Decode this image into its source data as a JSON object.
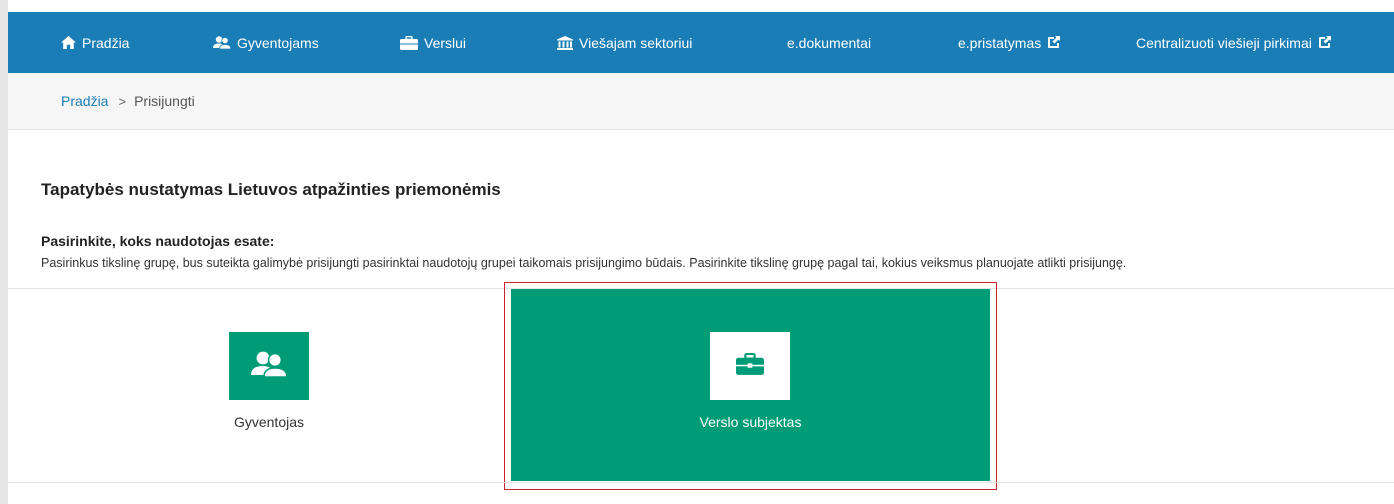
{
  "nav": {
    "items": [
      {
        "label": "Pradžia",
        "icon": "home-icon"
      },
      {
        "label": "Gyventojams",
        "icon": "users-icon"
      },
      {
        "label": "Verslui",
        "icon": "briefcase-icon"
      },
      {
        "label": "Viešajam sektoriui",
        "icon": "institution-icon"
      },
      {
        "label": "e.dokumentai",
        "icon": ""
      },
      {
        "label": "e.pristatymas",
        "icon": "external-link-icon"
      },
      {
        "label": "Centralizuoti viešieji pirkimai",
        "icon": "external-link-icon"
      }
    ]
  },
  "breadcrumb": {
    "home": "Pradžia",
    "separator": ">",
    "current": "Prisijungti"
  },
  "main": {
    "title": "Tapatybės nustatymas Lietuvos atpažinties priemonėmis",
    "subtitle": "Pasirinkite, koks naudotojas esate:",
    "description": "Pasirinkus tikslinę grupę, bus suteikta galimybė prisijungti pasirinktai naudotojų grupei taikomais prisijungimo būdais. Pasirinkite tikslinę grupę pagal tai, kokius veiksmus planuojate atlikti prisijungę."
  },
  "options": {
    "citizen": {
      "label": "Gyventojas",
      "icon": "users-icon"
    },
    "business": {
      "label": "Verslo subjektas",
      "icon": "briefcase-icon",
      "selected": true
    }
  },
  "colors": {
    "nav_bg": "#1a7db5",
    "accent_green": "#009b77",
    "highlight_border": "#d0202c",
    "link": "#1a7db5"
  }
}
